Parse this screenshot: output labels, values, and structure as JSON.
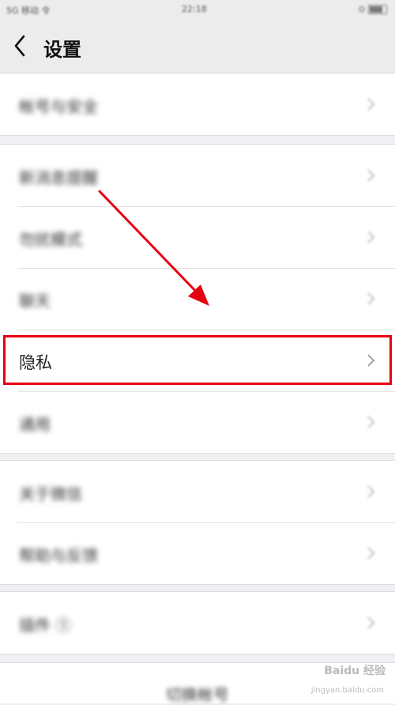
{
  "status_bar": {
    "carrier": "5G 移动 令",
    "time": "22:18",
    "right": "⊙"
  },
  "header": {
    "title": "设置"
  },
  "groups": [
    {
      "items": [
        {
          "label": "帐号与安全"
        }
      ]
    },
    {
      "items": [
        {
          "label": "新消息提醒"
        },
        {
          "label": "勿扰模式"
        },
        {
          "label": "聊天"
        },
        {
          "label": "隐私"
        },
        {
          "label": "通用"
        }
      ]
    },
    {
      "items": [
        {
          "label": "关于微信"
        },
        {
          "label": "帮助与反馈"
        }
      ]
    },
    {
      "items": [
        {
          "label": "插件 ①"
        }
      ]
    }
  ],
  "footer": {
    "label": "切换帐号"
  },
  "watermark": {
    "brand": "Baidu 经验",
    "url": "jingyan.baidu.com"
  },
  "colors": {
    "annotation": "#e60012"
  }
}
